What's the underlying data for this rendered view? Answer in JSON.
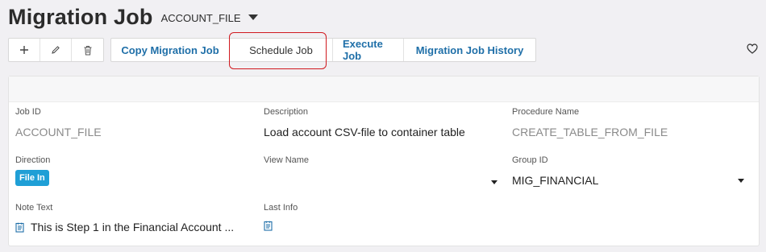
{
  "header": {
    "title": "Migration Job",
    "record_key": "ACCOUNT_FILE"
  },
  "toolbar": {
    "icons": [
      "add-icon",
      "edit-icon",
      "delete-icon"
    ],
    "commands": {
      "copy": "Copy Migration Job",
      "schedule": "Schedule Job",
      "execute": "Execute Job",
      "history": "Migration Job History"
    },
    "favorite_icon": "heart-icon"
  },
  "colors": {
    "link_blue": "#1f6fa8",
    "badge_blue": "#1f9fd6",
    "highlight_red": "#d0191f"
  },
  "fields": {
    "job_id": {
      "label": "Job ID",
      "value": "ACCOUNT_FILE"
    },
    "description": {
      "label": "Description",
      "value": "Load account CSV-file to container table"
    },
    "procedure_name": {
      "label": "Procedure Name",
      "value": "CREATE_TABLE_FROM_FILE"
    },
    "direction": {
      "label": "Direction",
      "value": "File In"
    },
    "view_name": {
      "label": "View Name",
      "value": ""
    },
    "group_id": {
      "label": "Group ID",
      "value": "MIG_FINANCIAL"
    },
    "note_text": {
      "label": "Note Text",
      "value": "This is Step 1 in the Financial Account ..."
    },
    "last_info": {
      "label": "Last Info",
      "value": ""
    }
  }
}
